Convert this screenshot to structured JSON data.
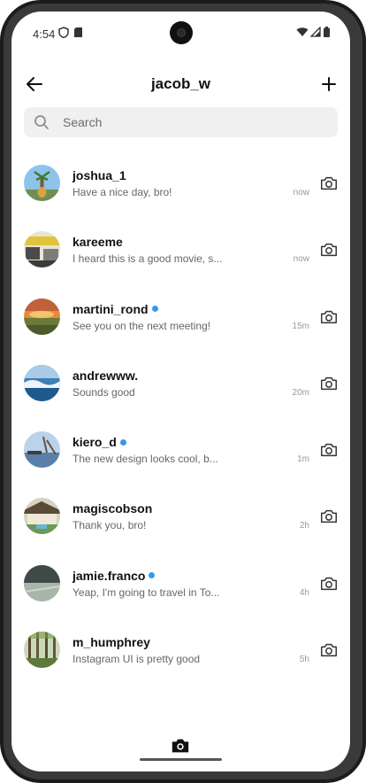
{
  "status_bar": {
    "time": "4:54"
  },
  "header": {
    "title": "jacob_w"
  },
  "search": {
    "placeholder": "Search"
  },
  "colors": {
    "online_dot": "#3797f0",
    "search_bg": "#f0f0f0"
  },
  "conversations": [
    {
      "username": "joshua_1",
      "message": "Have a nice day, bro!",
      "time": "now",
      "online": false
    },
    {
      "username": "kareeme",
      "message": "I heard this is a good movie, s...",
      "time": "now",
      "online": false
    },
    {
      "username": "martini_rond",
      "message": "See you on the next meeting!",
      "time": "15m",
      "online": true
    },
    {
      "username": "andrewww.",
      "message": "Sounds good",
      "time": "20m",
      "online": false
    },
    {
      "username": "kiero_d",
      "message": "The new design looks cool, b...",
      "time": "1m",
      "online": true
    },
    {
      "username": "magiscobson",
      "message": "Thank you, bro!",
      "time": "2h",
      "online": false
    },
    {
      "username": "jamie.franco",
      "message": "Yeap, I'm going to travel in To...",
      "time": "4h",
      "online": true
    },
    {
      "username": "m_humphrey",
      "message": "Instagram UI is pretty good",
      "time": "5h",
      "online": false
    }
  ],
  "icons": {
    "back": "arrow-left-icon",
    "new": "plus-icon",
    "search": "search-icon",
    "row_camera": "camera-icon",
    "bottom_camera": "camera-filled-icon"
  }
}
